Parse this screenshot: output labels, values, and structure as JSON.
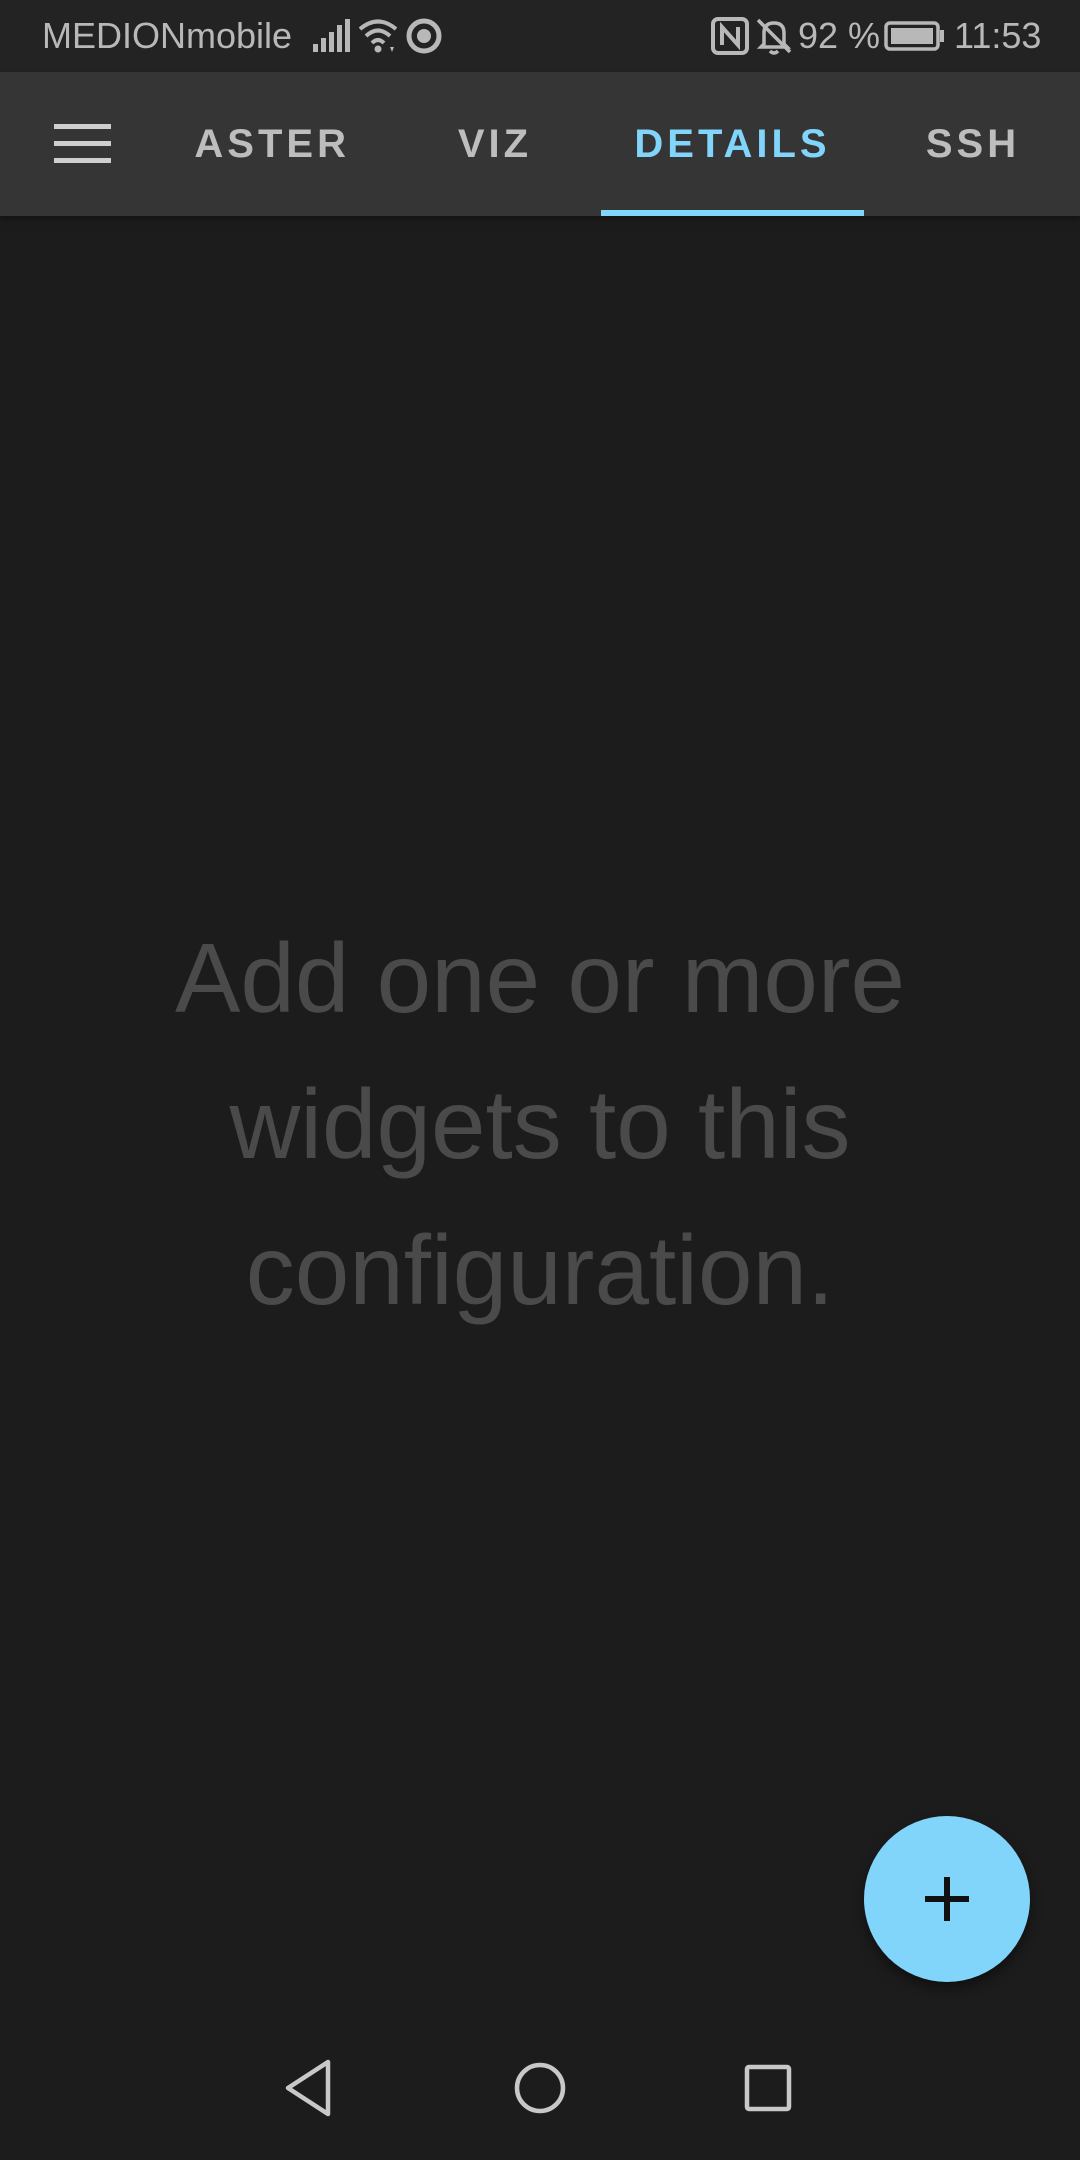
{
  "status_bar": {
    "carrier": "MEDIONmobile",
    "battery_percent": "92 %",
    "time": "11:53",
    "icons": [
      "signal-icon",
      "wifi-icon",
      "sync-icon",
      "nfc-icon",
      "bell-off-icon",
      "battery-icon"
    ]
  },
  "app_bar": {
    "menu_icon": "menu-icon",
    "tabs": [
      {
        "label": "ASTER",
        "selected": false
      },
      {
        "label": "VIZ",
        "selected": false
      },
      {
        "label": "DETAILS",
        "selected": true
      },
      {
        "label": "SSH",
        "selected": false
      }
    ]
  },
  "main": {
    "empty_message": "Add one or more\nwidgets to this\nconfiguration."
  },
  "fab": {
    "icon": "add-icon"
  },
  "nav_bar": {
    "icons": [
      "back-icon",
      "home-icon",
      "recents-icon"
    ]
  },
  "colors": {
    "accent": "#81d4fa",
    "background": "#1c1c1c",
    "app_bar": "#353535",
    "tab_text": "#bdbdbd",
    "empty_text": "#4a4a4a"
  }
}
